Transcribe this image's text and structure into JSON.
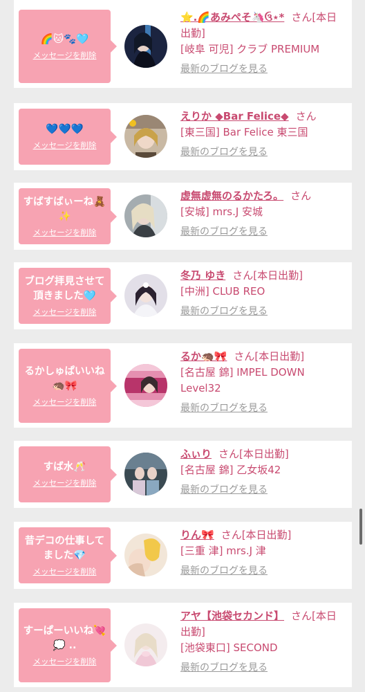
{
  "delete_label": "メッセージを削除",
  "blog_label": "最新のブログを見る",
  "honorific": "さん",
  "cards": [
    {
      "message": "🌈🐱🐾🩵",
      "name": "⭐️.🌈あみぺそ🦄ઉ⋆*",
      "honorific_suffix": "[本日出勤]",
      "store": "[岐阜 可児] クラブ PREMIUM",
      "avatar_color": "#1b2440"
    },
    {
      "message": "💙💙💙",
      "name": "えりか ◆Bar Felice◆",
      "honorific_suffix": "",
      "store": "[東三国] Bar Felice 東三国",
      "avatar_color": "#c9a98a"
    },
    {
      "message": "すばすばぃーね🧸\n✨",
      "name": "虚無虚無のるかたろ。",
      "honorific_suffix": "",
      "store": "[安城] mrs.J 安城",
      "avatar_color": "#9aa3a8"
    },
    {
      "message": "ブログ拝見させて\n頂きました🩵",
      "name": "冬乃 ゆき",
      "honorific_suffix": "[本日出勤]",
      "store": "[中洲] CLUB REO",
      "avatar_color": "#d9d6e2"
    },
    {
      "message": "るかしゅぱいいね\n🦔🎀",
      "name": "るか🦔🎀",
      "honorific_suffix": "[本日出勤]",
      "store": "[名古屋 錦] IMPEL DOWN Level32",
      "avatar_color": "#e86a9a"
    },
    {
      "message": "すば水🥂",
      "name": "ふぃり",
      "honorific_suffix": "[本日出勤]",
      "store": "[名古屋 錦] 乙女坂42",
      "avatar_color": "#3a4a52"
    },
    {
      "message": "昔デコの仕事して\nました💎",
      "name": "りん🎀",
      "honorific_suffix": "[本日出勤]",
      "store": "[三重 津] mrs.J 津",
      "avatar_color": "#e8c76a"
    },
    {
      "message": "すーぱーいいね💘\n💭 ..",
      "name": "アヤ【池袋セカンド】",
      "honorific_suffix": "[本日出勤]",
      "store": "[池袋東口] SECOND",
      "avatar_color": "#efe3e6"
    }
  ]
}
